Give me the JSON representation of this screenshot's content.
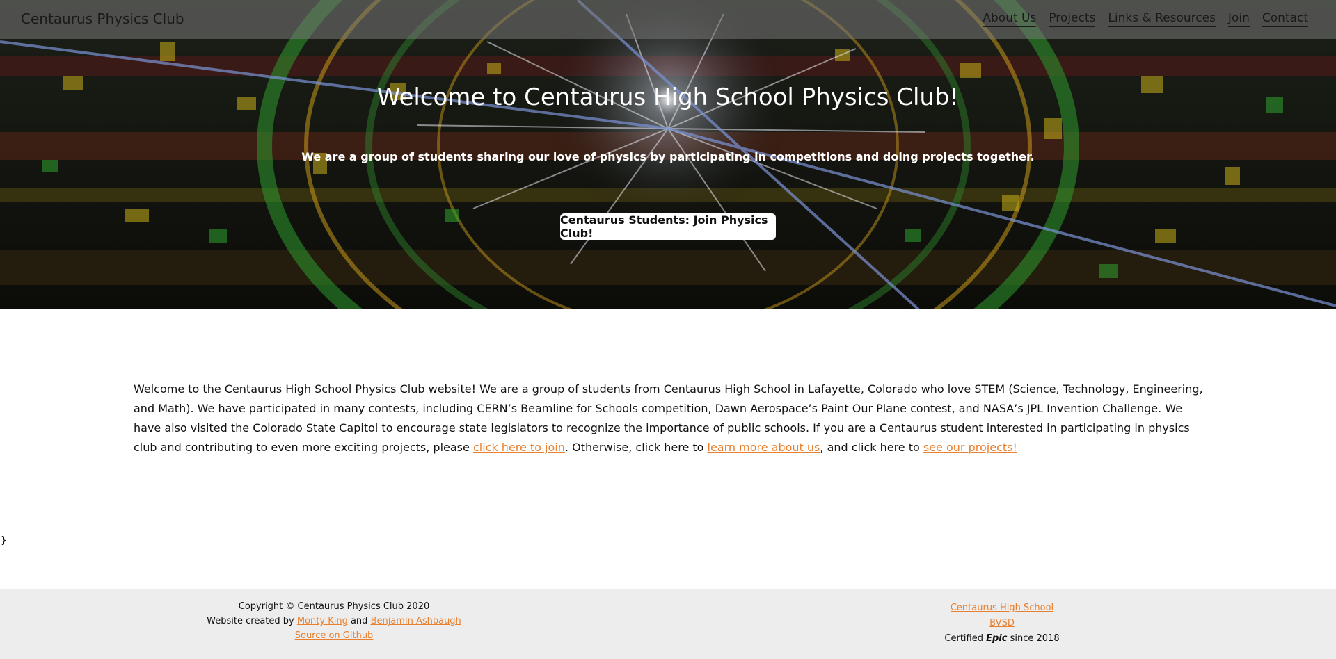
{
  "nav": {
    "brand": "Centaurus Physics Club",
    "links": [
      "About Us",
      "Projects",
      "Links & Resources",
      "Join",
      "Contact"
    ]
  },
  "hero": {
    "title": "Welcome to Centaurus High School Physics Club!",
    "subtitle": "We are a group of students sharing our love of physics by participating in competitions and doing projects together.",
    "cta_label": "Centaurus Students: Join Physics Club!"
  },
  "intro": {
    "text_before": "Welcome to the Centaurus High School Physics Club website! We are a group of students from Centaurus High School in Lafayette, Colorado who love STEM (Science, Technology, Engineering, and Math). We have participated in many contests, including CERN’s Beamline for Schools competition, Dawn Aerospace’s Paint Our Plane contest, and NASA’s JPL Invention Challenge. We have also visited the Colorado State Capitol to encourage state legislators to recognize the importance of public schools. If you are a Centaurus student interested in participating in physics club and contributing to even more exciting projects, please ",
    "join_link": "click here to join",
    "text_middle": ". Otherwise, click here to ",
    "about_link": "learn more about us",
    "text_middle2": ", and click here to ",
    "projects_link": "see our projects!",
    "stray_char": "}"
  },
  "footer": {
    "copyright": "Copyright © Centaurus Physics Club 2020",
    "created_prefix": "Website created by ",
    "author1": "Monty King",
    "and": " and ",
    "author2": "Benjamin Ashbaugh",
    "source_link": "Source on Github",
    "school_link": "Centaurus High School",
    "district_link": "BVSD",
    "certified_prefix": "Certified ",
    "certified_em": "Epic",
    "certified_suffix": " since 2018"
  },
  "colors": {
    "link": "#e8802f",
    "footer_bg": "#ededed",
    "nav_bg": "rgba(120,120,120,0.55)"
  }
}
